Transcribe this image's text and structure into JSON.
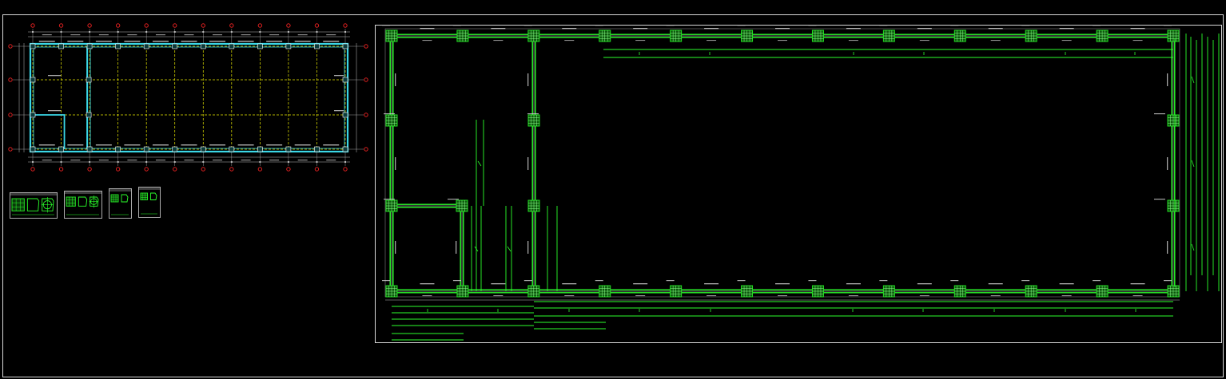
{
  "canvas": {
    "background": "#000000"
  },
  "colors": {
    "frame": "#d8d8d8",
    "grid_axis": "#e6e600",
    "wall_cyan": "#3ad7e6",
    "rebar_green": "#2bff2b",
    "column_green": "#22dd22",
    "axis_bubble": "#e02020",
    "dim_white": "#bdbdbd",
    "text_gray": "#cfcfcf"
  },
  "plan_overview": {
    "axis_columns": 12,
    "axis_rows": 4,
    "spans": 11
  },
  "detail_sheets": [
    {
      "id": "sheet-1",
      "cells": 3
    },
    {
      "id": "sheet-2",
      "cells": 3
    },
    {
      "id": "sheet-3",
      "cells": 2
    },
    {
      "id": "sheet-4",
      "cells": 2
    }
  ],
  "rebar_plan": {
    "top_columns": 12,
    "bottom_columns": 12
  }
}
